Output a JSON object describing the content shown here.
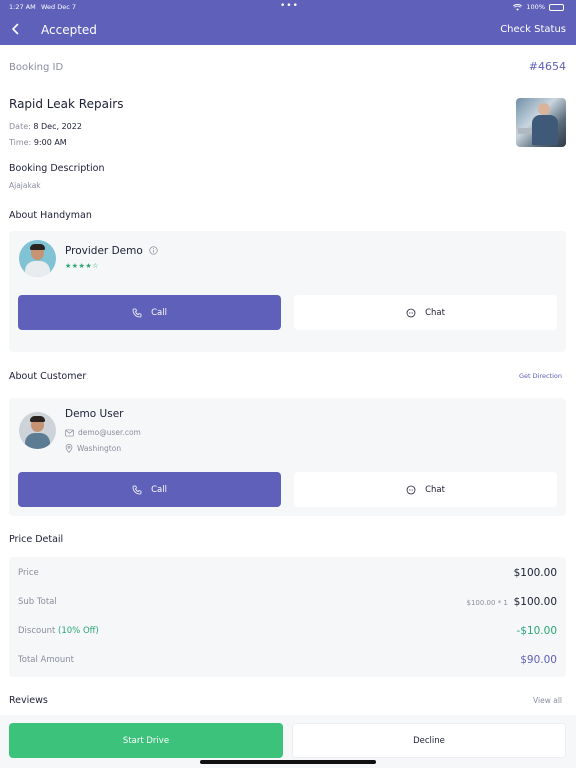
{
  "status_bar": {
    "time": "1:27 AM",
    "date": "Wed Dec 7",
    "dots": "•••",
    "battery": "100%"
  },
  "header": {
    "title": "Accepted",
    "check_status": "Check Status"
  },
  "booking": {
    "id_label": "Booking ID",
    "id_value": "#4654",
    "service_name": "Rapid Leak Repairs",
    "date_label": "Date:",
    "date_value": "8 Dec, 2022",
    "time_label": "Time:",
    "time_value": "9:00 AM",
    "description_title": "Booking Description",
    "description_text": "Ajajakak"
  },
  "handyman": {
    "section_title": "About Handyman",
    "name": "Provider Demo",
    "rating_stars": "★★★★☆",
    "call_label": "Call",
    "chat_label": "Chat"
  },
  "customer": {
    "section_title": "About Customer",
    "get_direction": "Get Direction",
    "name": "Demo User",
    "email": "demo@user.com",
    "location": "Washington",
    "call_label": "Call",
    "chat_label": "Chat"
  },
  "price": {
    "section_title": "Price Detail",
    "price_label": "Price",
    "price_value": "$100.00",
    "subtotal_label": "Sub Total",
    "subtotal_detail": "$100.00 * 1",
    "subtotal_value": "$100.00",
    "discount_label": "Discount",
    "discount_percent": "(10% Off)",
    "discount_value": "-$10.00",
    "total_label": "Total Amount",
    "total_value": "$90.00"
  },
  "reviews": {
    "section_title": "Reviews",
    "view_all": "View all"
  },
  "actions": {
    "start_drive": "Start Drive",
    "decline": "Decline"
  },
  "colors": {
    "primary": "#5f60b9",
    "green": "#3cc27b",
    "rating_green": "#2aa673"
  }
}
